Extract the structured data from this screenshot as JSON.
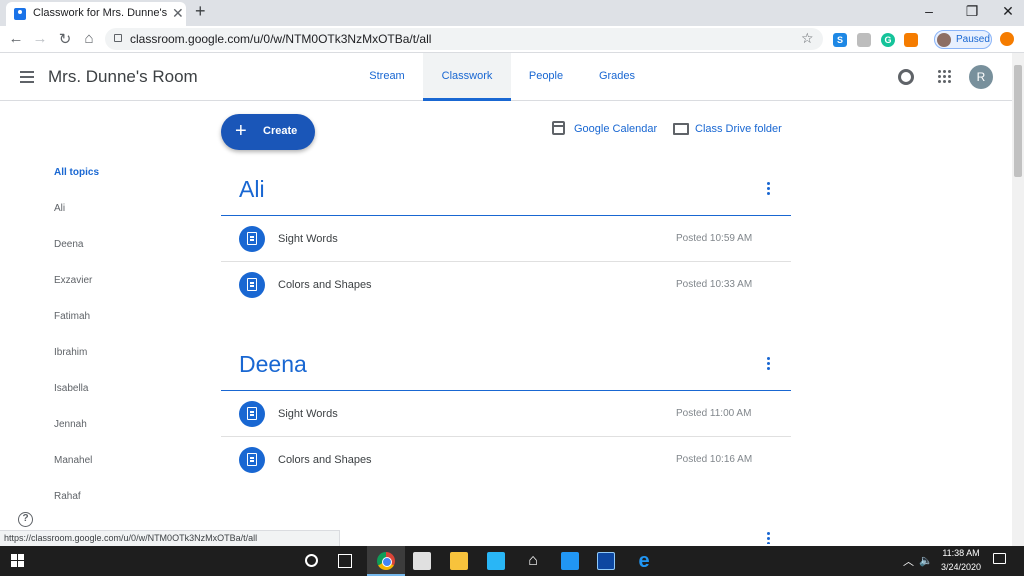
{
  "browser": {
    "tab_title": "Classwork for Mrs. Dunne's Room",
    "url": "classroom.google.com/u/0/w/NTM0OTk3NzMxOTBa/t/all",
    "profile_status": "Paused",
    "status_url": "https://classroom.google.com/u/0/w/NTM0OTk3NzMxOTBa/t/all"
  },
  "header": {
    "class_name": "Mrs. Dunne's Room",
    "tabs": [
      {
        "label": "Stream"
      },
      {
        "label": "Classwork"
      },
      {
        "label": "People"
      },
      {
        "label": "Grades"
      }
    ],
    "active_tab": "Classwork",
    "avatar_initial": "R"
  },
  "toolbar": {
    "create_label": "Create",
    "calendar_label": "Google Calendar",
    "drive_label": "Class Drive folder"
  },
  "topics": [
    "All topics",
    "Ali",
    "Deena",
    "Exzavier",
    "Fatimah",
    "Ibrahim",
    "Isabella",
    "Jennah",
    "Manahel",
    "Rahaf"
  ],
  "sections": [
    {
      "title": "Ali",
      "items": [
        {
          "title": "Sight Words",
          "posted": "Posted 10:59 AM"
        },
        {
          "title": "Colors and Shapes",
          "posted": "Posted 10:33 AM"
        }
      ]
    },
    {
      "title": "Deena",
      "items": [
        {
          "title": "Sight Words",
          "posted": "Posted 11:00 AM"
        },
        {
          "title": "Colors and Shapes",
          "posted": "Posted 10:16 AM"
        }
      ]
    }
  ],
  "taskbar": {
    "time": "11:38 AM",
    "date": "3/24/2020"
  },
  "colors": {
    "accent": "#1967d2",
    "create_button": "#1a56b8"
  }
}
